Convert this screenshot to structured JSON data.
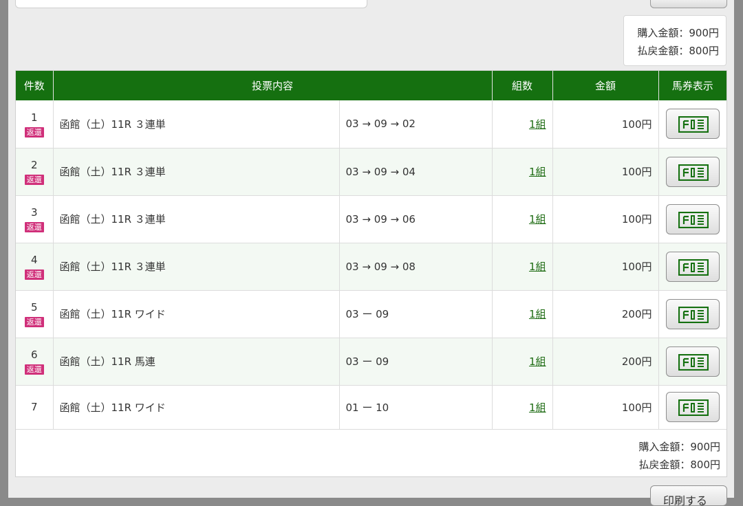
{
  "summary": {
    "purchase_label": "購入金額：",
    "purchase_amount": "900円",
    "refund_label": "払戻金額：",
    "refund_amount": "800円"
  },
  "table": {
    "headers": {
      "count": "件数",
      "content": "投票内容",
      "combos": "組数",
      "amount": "金額",
      "ticket": "馬券表示"
    },
    "rows": [
      {
        "num": "1",
        "badge": "返還",
        "race": "函館（土）11R ３連単",
        "selection": "03 → 09 → 02",
        "combos": "1組",
        "amount": "100円"
      },
      {
        "num": "2",
        "badge": "返還",
        "race": "函館（土）11R ３連単",
        "selection": "03 → 09 → 04",
        "combos": "1組",
        "amount": "100円"
      },
      {
        "num": "3",
        "badge": "返還",
        "race": "函館（土）11R ３連単",
        "selection": "03 → 09 → 06",
        "combos": "1組",
        "amount": "100円"
      },
      {
        "num": "4",
        "badge": "返還",
        "race": "函館（土）11R ３連単",
        "selection": "03 → 09 → 08",
        "combos": "1組",
        "amount": "100円"
      },
      {
        "num": "5",
        "badge": "返還",
        "race": "函館（土）11R ワイド",
        "selection": "03 ー 09",
        "combos": "1組",
        "amount": "200円"
      },
      {
        "num": "6",
        "badge": "返還",
        "race": "函館（土）11R 馬連",
        "selection": "03 ー 09",
        "combos": "1組",
        "amount": "200円"
      },
      {
        "num": "7",
        "badge": "",
        "race": "函館（土）11R ワイド",
        "selection": "01 ー 10",
        "combos": "1組",
        "amount": "100円"
      }
    ]
  },
  "print_button": "印刷する",
  "colors": {
    "header_green": "#157010",
    "badge_pink": "#d0307a",
    "link_green": "#1d6b12"
  }
}
